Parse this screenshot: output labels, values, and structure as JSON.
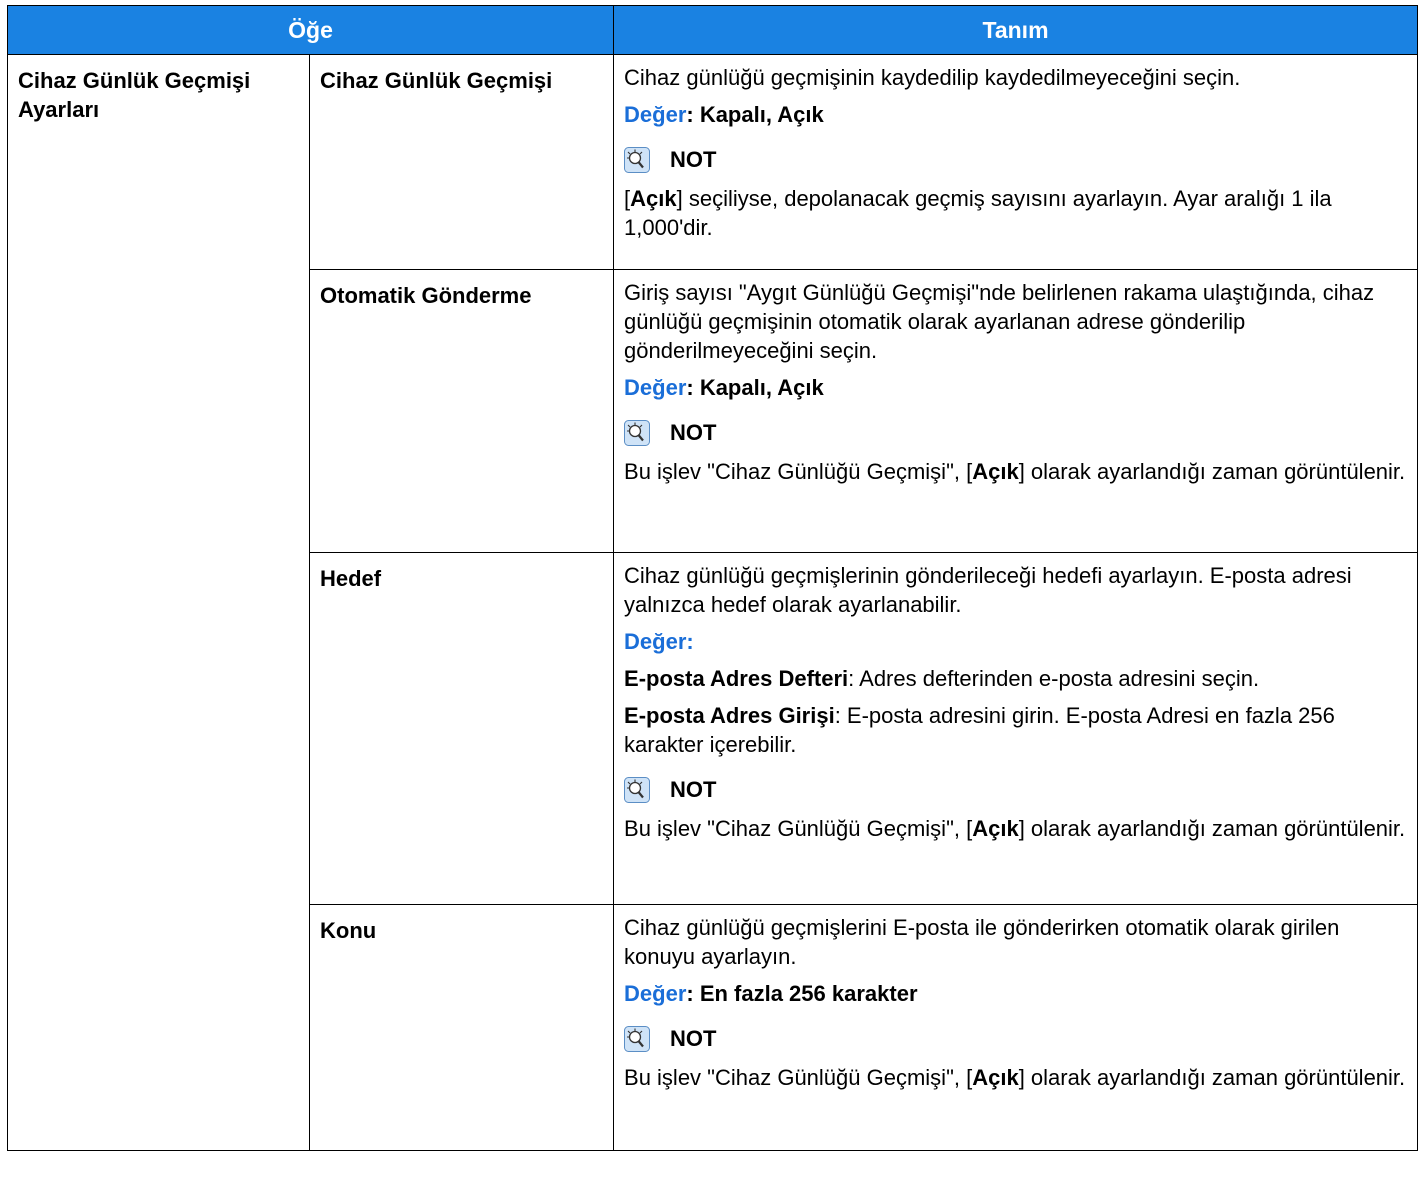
{
  "header": {
    "col1": "Öğe",
    "col2": "Tanım"
  },
  "group_label": "Cihaz Günlük Geçmişi Ayarları",
  "value_label": "Değer",
  "note_title": "NOT",
  "rows": [
    {
      "item": "Cihaz Günlük Geçmişi",
      "desc": "Cihaz günlüğü geçmişinin kaydedilip kaydedilmeyeceğini seçin.",
      "value": ": Kapalı, Açık",
      "note_pre": "[",
      "note_bold": "Açık",
      "note_post": "] seçiliyse, depolanacak geçmiş sayısını ayarlayın. Ayar aralığı 1 ila 1,000'dir."
    },
    {
      "item": "Otomatik Gönderme",
      "desc": "Giriş sayısı \"Aygıt Günlüğü Geçmişi\"nde belirlenen rakama ulaştığında, cihaz günlüğü geçmişinin otomatik olarak ayarlanan adrese gönderilip gönderilmeyeceğini seçin.",
      "value": ": Kapalı, Açık",
      "note_pre": "Bu işlev \"Cihaz Günlüğü Geçmişi\", [",
      "note_bold": "Açık",
      "note_post": "] olarak ayarlandığı zaman görüntülenir."
    },
    {
      "item": "Hedef",
      "desc": "Cihaz günlüğü geçmişlerinin gönderileceği hedefi ayarlayın. E-posta adresi yalnızca hedef olarak ayarlanabilir.",
      "value": ":",
      "opt1_bold": "E-posta Adres Defteri",
      "opt1_text": ": Adres defterinden e-posta adresini seçin.",
      "opt2_bold": "E-posta Adres Girişi",
      "opt2_text": ": E-posta adresini girin. E-posta Adresi en fazla 256 karakter içerebilir.",
      "note_pre": "Bu işlev \"Cihaz Günlüğü Geçmişi\", [",
      "note_bold": "Açık",
      "note_post": "] olarak ayarlandığı zaman görüntülenir."
    },
    {
      "item": "Konu",
      "desc": "Cihaz günlüğü geçmişlerini E-posta ile gönderirken otomatik olarak girilen konuyu ayarlayın.",
      "value": ": En fazla 256 karakter",
      "note_pre": "Bu işlev \"Cihaz Günlüğü Geçmişi\", [",
      "note_bold": "Açık",
      "note_post": "] olarak ayarlandığı zaman görüntülenir."
    }
  ]
}
